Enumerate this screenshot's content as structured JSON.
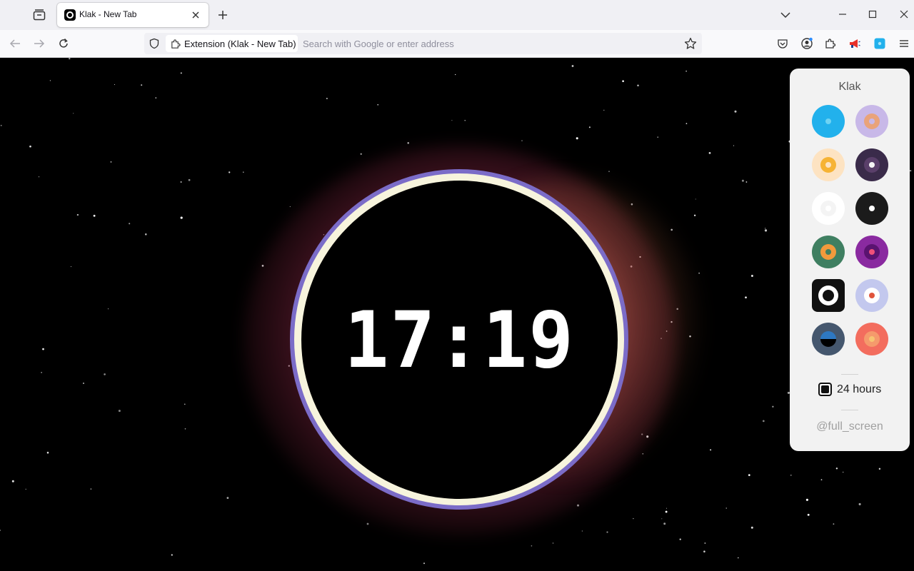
{
  "browser": {
    "tab": {
      "title": "Klak - New Tab"
    },
    "urlbar": {
      "identity_label": "Extension (Klak - New Tab)",
      "placeholder": "Search with Google or enter address"
    },
    "accent": "#0060df"
  },
  "clock": {
    "time": "17:19",
    "ring_outer_color": "#7b6cc8",
    "ring_inner_color": "#f7f4dd",
    "glow_color": "#e26e8c"
  },
  "panel": {
    "title": "Klak",
    "themes": [
      {
        "name": "cyan",
        "outer": "#22b1ec",
        "mid": "#22b1ec",
        "dot": "#6fd3f3"
      },
      {
        "name": "lavender",
        "outer": "#c8b8e8",
        "mid": "#e9a37a",
        "dot": "#c8b8e8"
      },
      {
        "name": "peach",
        "outer": "#fde3c2",
        "mid": "#f6b334",
        "dot": "#fde3c2"
      },
      {
        "name": "plum",
        "outer": "#3a2b4a",
        "mid": "#5a3f6a",
        "dot": "#f5f5f5"
      },
      {
        "name": "white",
        "outer": "#ffffff",
        "mid": "#f4f4f4",
        "dot": "#ffffff"
      },
      {
        "name": "black",
        "outer": "#1b1b1b",
        "mid": "#1b1b1b",
        "dot": "#ffffff"
      },
      {
        "name": "green",
        "outer": "#3f7f61",
        "mid": "#f29a3c",
        "dot": "#3f7f61"
      },
      {
        "name": "purple",
        "outer": "#8a2aa0",
        "mid": "#5a1370",
        "dot": "#f0507a"
      },
      {
        "name": "target",
        "outer": "#111111",
        "mid": "#ffffff",
        "dot": "#111111",
        "selected": true
      },
      {
        "name": "periwinkle",
        "outer": "#c3c8ee",
        "mid": "#ffffff",
        "dot": "#e0543c"
      },
      {
        "name": "slate",
        "outer": "#45576e",
        "mid": "#2e78c2",
        "dot": "#000000"
      },
      {
        "name": "coral",
        "outer": "#f36d5e",
        "mid": "#f59a6c",
        "dot": "#f7c472"
      }
    ],
    "hours_label": "24 hours",
    "hours_checked": true,
    "fullscreen_label": "@full_screen"
  }
}
